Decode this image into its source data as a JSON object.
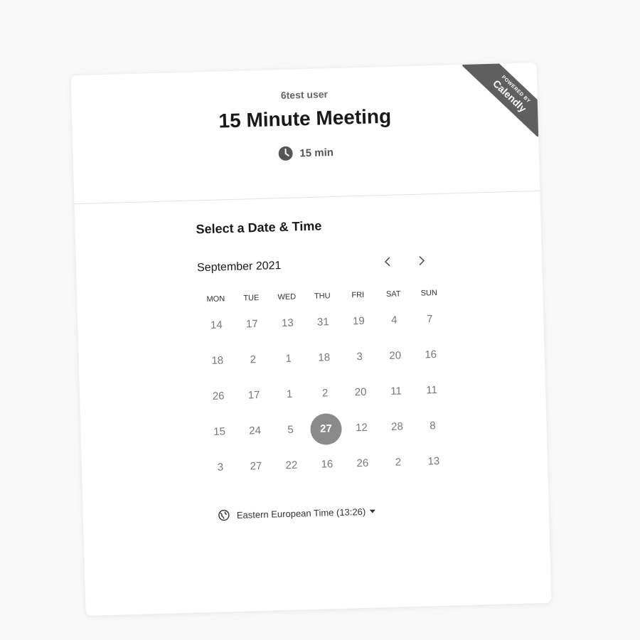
{
  "header": {
    "host_name": "6test user",
    "event_title": "15 Minute Meeting",
    "duration": "15 min",
    "duration_icon": "clock-icon"
  },
  "badge": {
    "small_text": "POWERED BY",
    "brand": "Calendly"
  },
  "scheduler": {
    "section_title": "Select a Date & Time",
    "month_label": "September 2021",
    "prev_icon": "chevron-left-icon",
    "next_icon": "chevron-right-icon",
    "weekdays": [
      "MON",
      "TUE",
      "WED",
      "THU",
      "FRI",
      "SAT",
      "SUN"
    ],
    "weeks": [
      [
        "14",
        "17",
        "13",
        "31",
        "19",
        "4",
        "7"
      ],
      [
        "18",
        "2",
        "1",
        "18",
        "3",
        "20",
        "16"
      ],
      [
        "26",
        "17",
        "1",
        "2",
        "20",
        "11",
        "11"
      ],
      [
        "15",
        "24",
        "5",
        "27",
        "12",
        "28",
        "8"
      ],
      [
        "3",
        "27",
        "22",
        "16",
        "26",
        "2",
        "13"
      ]
    ],
    "selected_day": "27",
    "timezone_label": "Eastern European Time (13:26)",
    "timezone_icon": "globe-icon"
  },
  "colors": {
    "background": "#f8f8f8",
    "selected_day_bg": "#8a8a8a",
    "ribbon": "#5f5f5f"
  }
}
